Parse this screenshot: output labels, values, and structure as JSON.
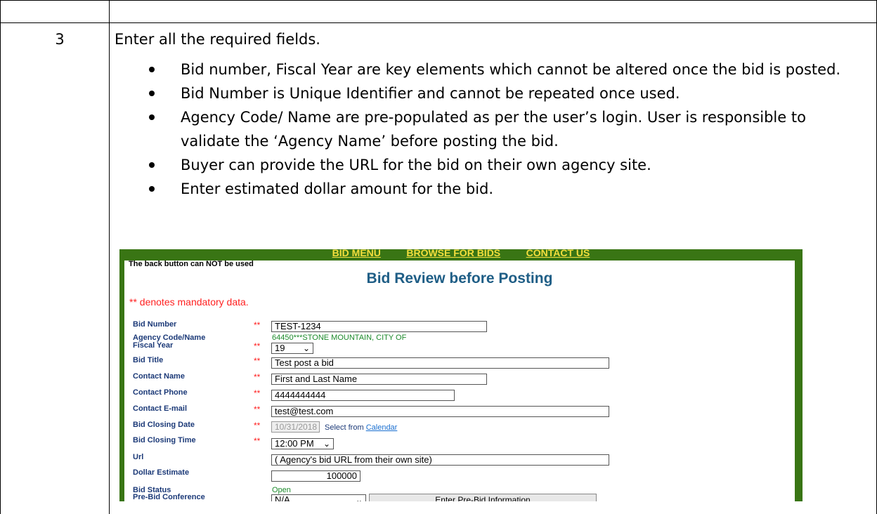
{
  "step": {
    "number": "3",
    "intro": "Enter all the required fields.",
    "bullets": [
      "Bid number, Fiscal Year are key elements which cannot be altered once the bid is posted.",
      "Bid Number is Unique Identifier and cannot be repeated once used.",
      "Agency Code/ Name are pre-populated as per the user’s login.  User is responsible to validate the ‘Agency Name’ before posting the bid.",
      "Buyer can provide the URL for the bid on their own agency site.",
      "Enter estimated dollar amount for the bid."
    ]
  },
  "screenshot": {
    "menu": [
      "BID MENU",
      "BROWSE FOR BIDS",
      "CONTACT US"
    ],
    "back_note": "The back button can NOT be used",
    "title": "Bid Review before Posting",
    "mandatory_note": "** denotes mandatory data.",
    "required_marker": "**",
    "fields": {
      "bid_number": {
        "label": "Bid Number",
        "value": "TEST-1234"
      },
      "agency": {
        "label": "Agency Code/Name",
        "value": "64450***STONE MOUNTAIN, CITY OF"
      },
      "fiscal_year": {
        "label": "Fiscal Year",
        "value": "19"
      },
      "bid_title": {
        "label": "Bid Title",
        "value": "Test post a bid"
      },
      "contact_name": {
        "label": "Contact Name",
        "value": "First and Last Name"
      },
      "contact_phone": {
        "label": "Contact Phone",
        "value": "4444444444"
      },
      "contact_email": {
        "label": "Contact E-mail",
        "value": "test@test.com"
      },
      "closing_date": {
        "label": "Bid Closing Date",
        "value": "10/31/2018",
        "select_from": "Select from",
        "calendar_link": "Calendar"
      },
      "closing_time": {
        "label": "Bid Closing Time",
        "value": "12:00 PM"
      },
      "url": {
        "label": "Url",
        "value": "( Agency's bid URL from their own site)"
      },
      "dollar_estimate": {
        "label": "Dollar Estimate",
        "value": "100000"
      },
      "bid_status": {
        "label": "Bid Status",
        "value": "Open"
      },
      "pre_bid": {
        "label": "Pre-Bid Conference",
        "value": "N/A",
        "button": "Enter Pre-Bid Information"
      }
    }
  }
}
